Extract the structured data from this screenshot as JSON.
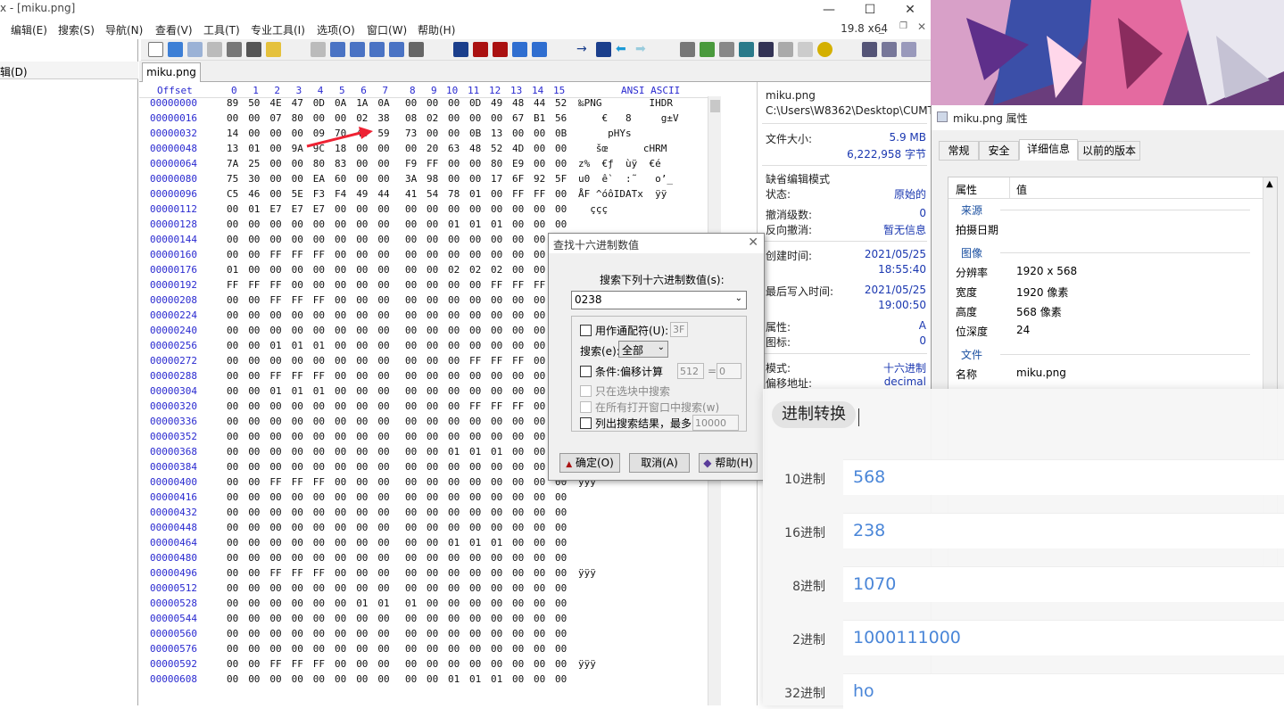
{
  "window": {
    "title": "x - [miku.png]",
    "version": "19.8 x64",
    "min_label": "—",
    "max_label": "☐",
    "close_label": "✕"
  },
  "menu": [
    "编辑(E)",
    "搜索(S)",
    "导航(N)",
    "查看(V)",
    "工具(T)",
    "专业工具(I)",
    "选项(O)",
    "窗口(W)",
    "帮助(H)"
  ],
  "left_pane": {
    "header": "辑(D)"
  },
  "file_tab": "miku.png",
  "hex": {
    "offset_label": "Offset",
    "columns": [
      "0",
      "1",
      "2",
      "3",
      "4",
      "5",
      "6",
      "7",
      "8",
      "9",
      "10",
      "11",
      "12",
      "13",
      "14",
      "15"
    ],
    "ascii_label": "ANSI ASCII",
    "rows": [
      {
        "off": "00000000",
        "b": "89 50 4E 47 0D 0A 1A 0A 00 00 00 0D 49 48 44 52",
        "a": "‰PNG        IHDR"
      },
      {
        "off": "00000016",
        "b": "00 00 07 80 00 00 02 38 08 02 00 00 00 67 B1 56",
        "a": "    €   8     g±V"
      },
      {
        "off": "00000032",
        "b": "14 00 00 00 09 70 48 59 73 00 00 0B 13 00 00 0B",
        "a": "     pHYs"
      },
      {
        "off": "00000048",
        "b": "13 01 00 9A 9C 18 00 00 00 20 63 48 52 4D 00 00",
        "a": "   šœ      cHRM"
      },
      {
        "off": "00000064",
        "b": "7A 25 00 00 80 83 00 00 F9 FF 00 00 80 E9 00 00",
        "a": "z%  €ƒ  ùÿ  €é"
      },
      {
        "off": "00000080",
        "b": "75 30 00 00 EA 60 00 00 3A 98 00 00 17 6F 92 5F",
        "a": "u0  ê`  :˜   o’_"
      },
      {
        "off": "00000096",
        "b": "C5 46 00 5E F3 F4 49 44 41 54 78 01 00 FF FF 00",
        "a": "ÅF ^óôIDATx  ÿÿ"
      },
      {
        "off": "00000112",
        "b": "00 01 E7 E7 E7 00 00 00 00 00 00 00 00 00 00 00",
        "a": "  ççç"
      },
      {
        "off": "00000128",
        "b": "00 00 00 00 00 00 00 00 00 00 01 01 01 00 00 00",
        "a": ""
      },
      {
        "off": "00000144",
        "b": "00 00 00 00 00 00 00 00 00 00 00 00 00 00 00 00",
        "a": ""
      },
      {
        "off": "00000160",
        "b": "00 00 FF FF FF 00 00 00 00 00 00 00 00 00 00 01",
        "a": ""
      },
      {
        "off": "00000176",
        "b": "01 00 00 00 00 00 00 00 00 00 02 02 02 00 00 00",
        "a": ""
      },
      {
        "off": "00000192",
        "b": "FF FF FF 00 00 00 00 00 00 00 00 00 FF FF FF 00",
        "a": ""
      },
      {
        "off": "00000208",
        "b": "00 00 FF FF FF 00 00 00 00 00 00 00 00 00 00 00",
        "a": ""
      },
      {
        "off": "00000224",
        "b": "00 00 00 00 00 00 00 00 00 00 00 00 00 00 00 00",
        "a": ""
      },
      {
        "off": "00000240",
        "b": "00 00 00 00 00 00 00 00 00 00 00 00 00 00 00 00",
        "a": ""
      },
      {
        "off": "00000256",
        "b": "00 00 01 01 01 00 00 00 00 00 00 00 00 00 00 00",
        "a": ""
      },
      {
        "off": "00000272",
        "b": "00 00 00 00 00 00 00 00 00 00 00 FF FF FF 00 00",
        "a": ""
      },
      {
        "off": "00000288",
        "b": "00 00 FF FF FF 00 00 00 00 00 00 00 00 00 00 00",
        "a": ""
      },
      {
        "off": "00000304",
        "b": "00 00 01 01 01 00 00 00 00 00 00 00 00 00 00 00",
        "a": ""
      },
      {
        "off": "00000320",
        "b": "00 00 00 00 00 00 00 00 00 00 00 FF FF FF 00 00",
        "a": ""
      },
      {
        "off": "00000336",
        "b": "00 00 00 00 00 00 00 00 00 00 00 00 00 00 00 00",
        "a": ""
      },
      {
        "off": "00000352",
        "b": "00 00 00 00 00 00 00 00 00 00 00 00 00 00 00 00",
        "a": ""
      },
      {
        "off": "00000368",
        "b": "00 00 00 00 00 00 00 00 00 00 01 01 01 00 00 00",
        "a": ""
      },
      {
        "off": "00000384",
        "b": "00 00 00 00 00 00 00 00 00 00 00 00 00 00 00 00",
        "a": ""
      },
      {
        "off": "00000400",
        "b": "00 00 FF FF FF 00 00 00 00 00 00 00 00 00 00 00",
        "a": "ÿÿÿ"
      },
      {
        "off": "00000416",
        "b": "00 00 00 00 00 00 00 00 00 00 00 00 00 00 00 00",
        "a": ""
      },
      {
        "off": "00000432",
        "b": "00 00 00 00 00 00 00 00 00 00 00 00 00 00 00 00",
        "a": ""
      },
      {
        "off": "00000448",
        "b": "00 00 00 00 00 00 00 00 00 00 00 00 00 00 00 00",
        "a": ""
      },
      {
        "off": "00000464",
        "b": "00 00 00 00 00 00 00 00 00 00 01 01 01 00 00 00",
        "a": ""
      },
      {
        "off": "00000480",
        "b": "00 00 00 00 00 00 00 00 00 00 00 00 00 00 00 00",
        "a": ""
      },
      {
        "off": "00000496",
        "b": "00 00 FF FF FF 00 00 00 00 00 00 00 00 00 00 00",
        "a": "ÿÿÿ"
      },
      {
        "off": "00000512",
        "b": "00 00 00 00 00 00 00 00 00 00 00 00 00 00 00 00",
        "a": ""
      },
      {
        "off": "00000528",
        "b": "00 00 00 00 00 00 01 01 01 00 00 00 00 00 00 00",
        "a": ""
      },
      {
        "off": "00000544",
        "b": "00 00 00 00 00 00 00 00 00 00 00 00 00 00 00 00",
        "a": ""
      },
      {
        "off": "00000560",
        "b": "00 00 00 00 00 00 00 00 00 00 00 00 00 00 00 00",
        "a": ""
      },
      {
        "off": "00000576",
        "b": "00 00 00 00 00 00 00 00 00 00 00 00 00 00 00 00",
        "a": ""
      },
      {
        "off": "00000592",
        "b": "00 00 FF FF FF 00 00 00 00 00 00 00 00 00 00 00",
        "a": "ÿÿÿ"
      },
      {
        "off": "00000608",
        "b": "00 00 00 00 00 00 00 00 00 00 01 01 01 00 00 00",
        "a": ""
      }
    ]
  },
  "info": {
    "filename": "miku.png",
    "path": "C:\\Users\\W8362\\Desktop\\CUMT",
    "size_label": "文件大小:",
    "size_mb": "5.9 MB",
    "size_bytes": "6,222,958 字节",
    "mode": "缺省编辑模式",
    "state_label": "状态:",
    "state_value": "原始的",
    "undo_label": "撤消级数:",
    "undo_value": "0",
    "redo_label": "反向撤消:",
    "redo_value": "暂无信息",
    "created_label": "创建时间:",
    "created_date": "2021/05/25",
    "created_time": "18:55:40",
    "modified_label": "最后写入时间:",
    "modified_date": "2021/05/25",
    "modified_time": "19:00:50",
    "attr_label": "属性:",
    "attr_value": "A",
    "icon_label": "图标:",
    "icon_value": "0",
    "mode2_label": "模式:",
    "mode2_value": "十六进制",
    "offset_label": "偏移地址:",
    "offset_value": "decimal"
  },
  "find_dialog": {
    "title": "查找十六进制数值",
    "prompt": "搜索下列十六进制数值(s):",
    "value": "0238",
    "wildcard_label": "用作通配符(U):",
    "wildcard_value": "3F",
    "search_label": "搜索(e):",
    "search_value": "全部",
    "cond_label": "条件:偏移计算",
    "cond_value": "512",
    "cond_eq": "=",
    "cond_result": "0",
    "in_selection": "只在选块中搜索",
    "all_windows": "在所有打开窗口中搜索(w)",
    "list_label": "列出搜索结果，最多",
    "list_value": "10000",
    "ok": "确定(O)",
    "cancel": "取消(A)",
    "help": "帮助(H)"
  },
  "props": {
    "title": "miku.png 属性",
    "tabs": [
      "常规",
      "安全",
      "详细信息",
      "以前的版本"
    ],
    "col_prop": "属性",
    "col_value": "值",
    "sec_source": "来源",
    "shot_date": "拍摄日期",
    "sec_image": "图像",
    "res_label": "分辨率",
    "res_value": "1920 x 568",
    "w_label": "宽度",
    "w_value": "1920 像素",
    "h_label": "高度",
    "h_value": "568 像素",
    "depth_label": "位深度",
    "depth_value": "24",
    "sec_file": "文件",
    "name_label": "名称",
    "name_value": "miku.png"
  },
  "converter": {
    "title": "进制转换",
    "rows": [
      {
        "label": "10进制",
        "value": "568"
      },
      {
        "label": "16进制",
        "value": "238"
      },
      {
        "label": "8进制",
        "value": "1070"
      },
      {
        "label": "2进制",
        "value": "1000111000"
      },
      {
        "label": "32进制",
        "value": "ho"
      }
    ]
  }
}
